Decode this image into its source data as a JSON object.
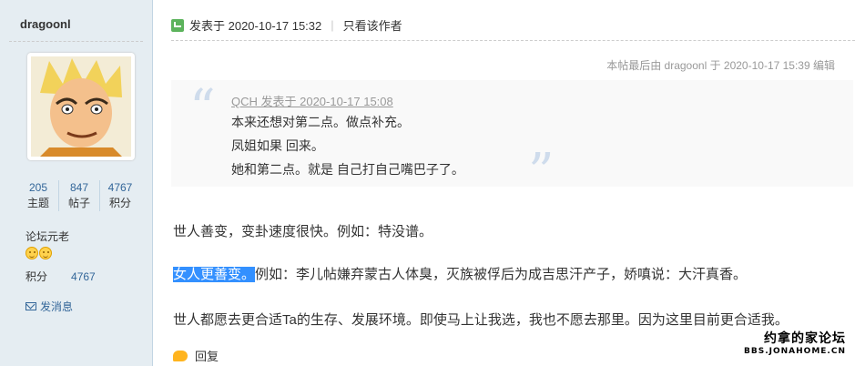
{
  "user": {
    "name": "dragoonl",
    "stats": [
      {
        "value": "205",
        "label": "主题"
      },
      {
        "value": "847",
        "label": "帖子"
      },
      {
        "value": "4767",
        "label": "积分"
      }
    ],
    "rank": "论坛元老",
    "points_label": "积分",
    "points_value": "4767",
    "pm_label": "发消息"
  },
  "post": {
    "posted_label": "发表于 2020-10-17 15:32",
    "separator": "|",
    "author_only": "只看该作者",
    "last_edit": "本帖最后由 dragoonl 于 2020-10-17 15:39 编辑",
    "quote": {
      "header": "QCH 发表于 2020-10-17 15:08",
      "lines": [
        "本来还想对第二点。做点补充。",
        "凤姐如果 回来。",
        "她和第二点。就是 自己打自己嘴巴子了。"
      ]
    },
    "para1": "世人善变，变卦速度很快。例如：特没谱。",
    "para2_highlight": "女人更善变。",
    "para2_rest": "例如：李儿帖嫌弃蒙古人体臭，灭族被俘后为成吉思汗产子，娇嗔说：大汗真香。",
    "para3": "世人都愿去更合适Ta的生存、发展环境。即使马上让我选，我也不愿去那里。因为这里目前更合适我。",
    "reply_label": "回复"
  },
  "watermark": {
    "cn": "约拿的家论坛",
    "en": "BBS.JONAHOME.CN"
  },
  "colors": {
    "sidebar_bg": "#e5edf2",
    "link": "#336699",
    "highlight": "#3390ff"
  }
}
